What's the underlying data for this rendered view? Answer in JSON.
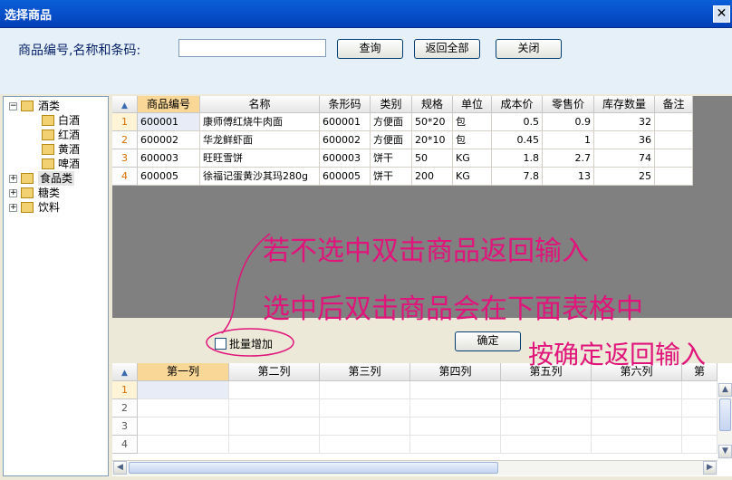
{
  "window": {
    "title": "选择商品"
  },
  "search": {
    "label": "商品编号,名称和条码:",
    "value": "",
    "placeholder": "",
    "query_label": "查询",
    "return_all_label": "返回全部",
    "close_label": "关闭"
  },
  "tree": {
    "nodes": [
      {
        "label": "酒类",
        "expanded": true
      },
      {
        "label": "白酒"
      },
      {
        "label": "红酒"
      },
      {
        "label": "黄酒"
      },
      {
        "label": "啤酒"
      },
      {
        "label": "食品类",
        "expanded": false
      },
      {
        "label": "糖类",
        "expanded": false
      },
      {
        "label": "饮料",
        "expanded": false
      }
    ]
  },
  "goods_table": {
    "columns": [
      "商品编号",
      "名称",
      "条形码",
      "类别",
      "规格",
      "单位",
      "成本价",
      "零售价",
      "库存数量",
      "备注"
    ],
    "rows": [
      {
        "no": "1",
        "cells": [
          "600001",
          "康师傅红烧牛肉面",
          "600001",
          "方便面",
          "50*20",
          "包",
          "0.5",
          "0.9",
          "32",
          ""
        ]
      },
      {
        "no": "2",
        "cells": [
          "600002",
          "华龙鲜虾面",
          "600002",
          "方便面",
          "20*10",
          "包",
          "0.45",
          "1",
          "36",
          ""
        ]
      },
      {
        "no": "3",
        "cells": [
          "600003",
          "旺旺雪饼",
          "600003",
          "饼干",
          "50",
          "KG",
          "1.8",
          "2.7",
          "74",
          ""
        ]
      },
      {
        "no": "4",
        "cells": [
          "600005",
          "徐福记蛋黄沙其玛280g",
          "600005",
          "饼干",
          "200",
          "KG",
          "7.8",
          "13",
          "25",
          ""
        ]
      }
    ]
  },
  "batch": {
    "checkbox_label": "批量增加",
    "checked": false,
    "confirm_label": "确定"
  },
  "selected_table": {
    "columns": [
      "第一列",
      "第二列",
      "第三列",
      "第四列",
      "第五列",
      "第六列",
      "第"
    ],
    "row_numbers": [
      "1",
      "2",
      "3",
      "4"
    ]
  },
  "annotations": {
    "line1": "若不选中双击商品返回输入",
    "line2": "选中后双击商品会在下面表格中",
    "line3": "按确定返回输入"
  },
  "colors": {
    "annotation": "#e0147a",
    "selected_header": "#f9d796",
    "title_bar": "#0a5fd9"
  }
}
